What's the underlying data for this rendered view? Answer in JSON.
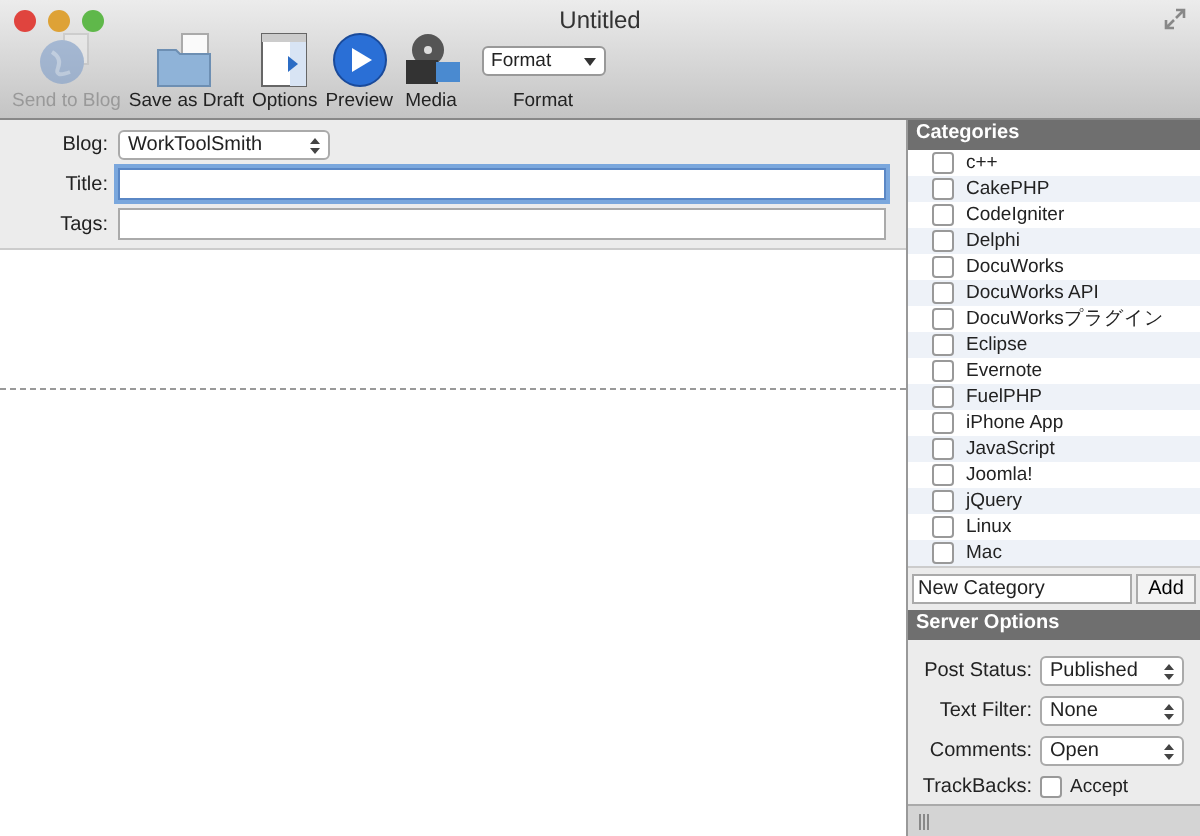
{
  "window": {
    "title": "Untitled"
  },
  "toolbar": [
    {
      "kind": "globe",
      "label": "Send to Blog",
      "disabled": true
    },
    {
      "kind": "folder",
      "label": "Save as Draft",
      "disabled": false
    },
    {
      "kind": "panel",
      "label": "Options",
      "disabled": false
    },
    {
      "kind": "play",
      "label": "Preview",
      "disabled": false
    },
    {
      "kind": "film",
      "label": "Media",
      "disabled": false
    },
    {
      "kind": "dropdown",
      "value": "Format",
      "label": "Format"
    }
  ],
  "form": {
    "blog": {
      "label": "Blog:",
      "value": "WorkToolSmith"
    },
    "title": {
      "label": "Title:",
      "focused": true
    },
    "tags": {
      "label": "Tags:",
      "focused": false
    }
  },
  "categories": {
    "title": "Categories",
    "items": [
      {
        "label": "c++",
        "checked": false
      },
      {
        "label": "CakePHP",
        "checked": false
      },
      {
        "label": "CodeIgniter",
        "checked": false
      },
      {
        "label": "Delphi",
        "checked": false
      },
      {
        "label": "DocuWorks",
        "checked": false
      },
      {
        "label": "DocuWorks API",
        "checked": false
      },
      {
        "label": "DocuWorksプラグイン",
        "checked": false
      },
      {
        "label": "Eclipse",
        "checked": false
      },
      {
        "label": "Evernote",
        "checked": false
      },
      {
        "label": "FuelPHP",
        "checked": false
      },
      {
        "label": "iPhone App",
        "checked": false
      },
      {
        "label": "JavaScript",
        "checked": false
      },
      {
        "label": "Joomla!",
        "checked": false
      },
      {
        "label": "jQuery",
        "checked": false
      },
      {
        "label": "Linux",
        "checked": false
      },
      {
        "label": "Mac",
        "checked": false
      }
    ],
    "new_category": "New Category",
    "add_button": "Add"
  },
  "server_options": {
    "title": "Server Options",
    "selects": [
      {
        "label": "Post Status:",
        "value": "Published"
      },
      {
        "label": "Text Filter:",
        "value": "None"
      },
      {
        "label": "Comments:",
        "value": "Open"
      }
    ],
    "trackbacks": {
      "label": "TrackBacks:",
      "option": "Accept",
      "checked": false
    }
  }
}
